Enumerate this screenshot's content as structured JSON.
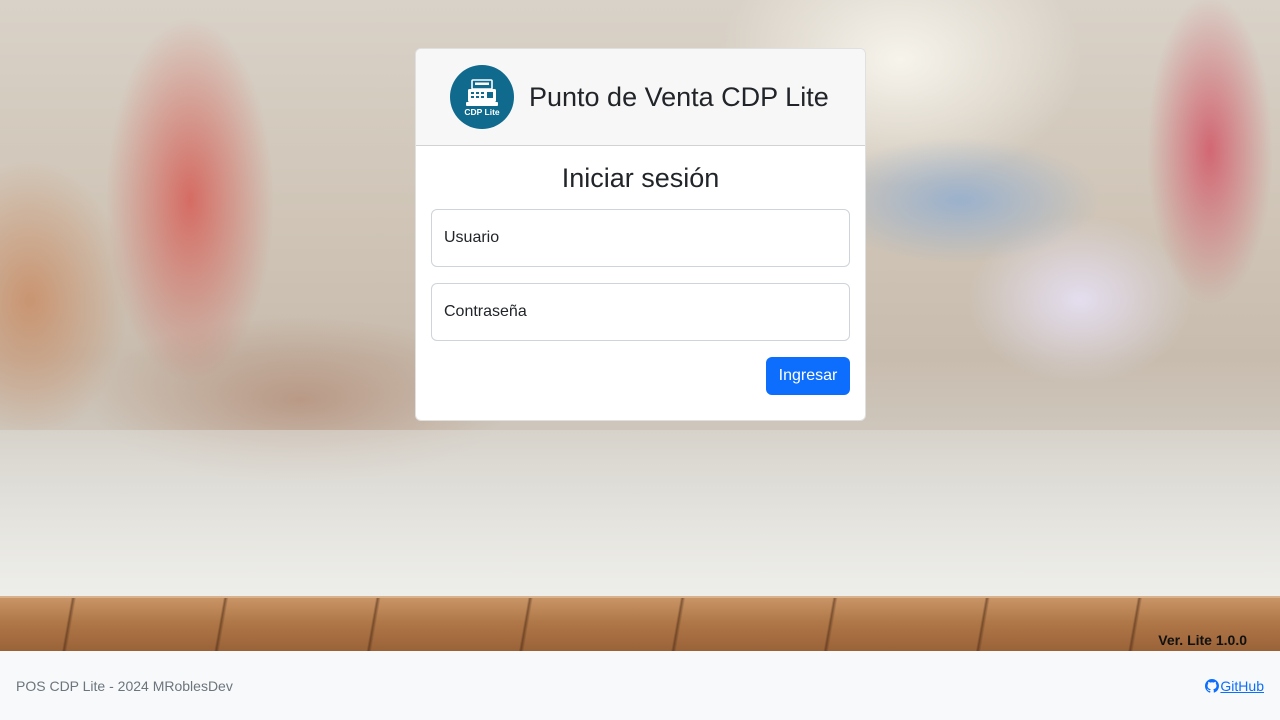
{
  "app": {
    "brand_title": "Punto de Venta CDP Lite",
    "logo_text": "CDP Lite",
    "version_label": "Ver. Lite 1.0.0"
  },
  "login": {
    "heading": "Iniciar sesión",
    "username_placeholder": "Usuario",
    "password_placeholder": "Contraseña",
    "submit_label": "Ingresar"
  },
  "footer": {
    "copyright": "POS CDP Lite - 2024 MRoblesDev",
    "github_label": " GitHub",
    "github_icon": "github-icon"
  },
  "colors": {
    "primary": "#0d6efd",
    "logo_bg": "#0f6a8e",
    "footer_bg": "#f8f9fa"
  }
}
